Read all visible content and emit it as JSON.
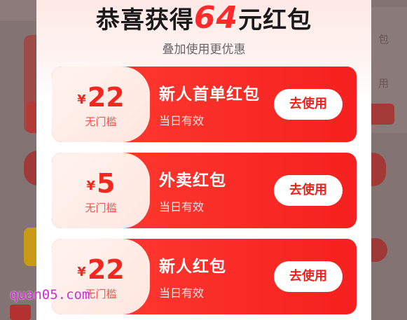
{
  "background": {
    "right_texts": [
      "包",
      "用"
    ]
  },
  "popup": {
    "title_prefix": "恭喜获得",
    "title_amount": "64",
    "title_suffix": "元红包",
    "subtitle": "叠加使用更优惠"
  },
  "coupons": [
    {
      "currency": "¥",
      "amount": "22",
      "condition": "无门槛",
      "name": "新人首单红包",
      "validity": "当日有效",
      "button": "去使用"
    },
    {
      "currency": "¥",
      "amount": "5",
      "condition": "无门槛",
      "name": "外卖红包",
      "validity": "当日有效",
      "button": "去使用"
    },
    {
      "currency": "¥",
      "amount": "22",
      "condition": "无门槛",
      "name": "新人红包",
      "validity": "当日有效",
      "button": "去使用"
    }
  ],
  "watermark": "quan05.com",
  "colors": {
    "accent": "#f4271e",
    "overlay": "#847373"
  }
}
